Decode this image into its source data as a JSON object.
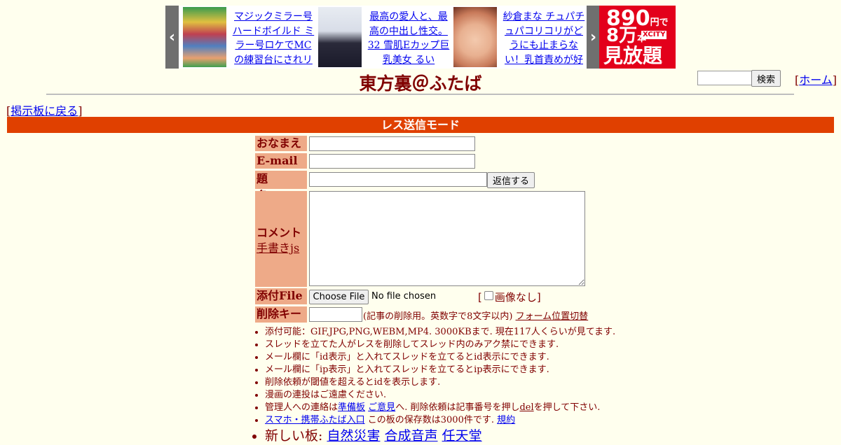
{
  "ads": {
    "prev": "‹",
    "next": "›",
    "items": [
      {
        "text": "マジックミラー号ハードボイルド ミラー号ロケでMCの練習台にされリハ"
      },
      {
        "text": "最高の愛人と、最高の中出し性交。32 雪肌Eカップ巨乳美女 るい"
      },
      {
        "text": "紗倉まな チュパチュパコリコリがどうにも止まらない！乳首責めが好"
      }
    ],
    "banner": {
      "line1": "890",
      "line1_unit": "円で",
      "line2": "8万",
      "line2_unit": "本",
      "brand": "XCITY",
      "line3": "見放題"
    }
  },
  "header": {
    "title": "東方裏＠ふたば",
    "search_button": "検索",
    "home_link": "ホーム",
    "back_link": "掲示板に戻る"
  },
  "mode_label": "レス送信モード",
  "form": {
    "name_label": "おなまえ",
    "email_label": "E-mail",
    "subject_label": "題　名",
    "reply_button": "返信する",
    "comment_label": "コメント",
    "tegaki_link": "手書きjs",
    "file_label": "添付File",
    "choose_file": "Choose File",
    "no_file": "No file chosen",
    "no_image": "画像なし",
    "delkey_label": "削除キー",
    "delkey_note": "(記事の削除用。英数字で8文字以内)",
    "form_toggle": "フォーム位置切替"
  },
  "notes": {
    "n1": "添付可能：GIF,JPG,PNG,WEBM,MP4. 3000KBまで. 現在117人くらいが見てます.",
    "n2": "スレッドを立てた人がレスを削除してスレッド内のみアク禁にできます.",
    "n3": "メール欄に「id表示」と入れてスレッドを立てるとid表示にできます.",
    "n4": "メール欄に「ip表示」と入れてスレッドを立てるとip表示にできます.",
    "n5": "削除依頼が閾値を超えるとidを表示します.",
    "n6": "漫画の連投はご遠慮ください.",
    "n7_pre": "管理人への連絡は",
    "n7_link1": "準備板",
    "n7_link2": "ご意見",
    "n7_mid": "へ. 削除依頼は記事番号を押し",
    "n7_del": "del",
    "n7_post": "を押して下さい.",
    "n8_link": "スマホ・携帯ふたば入口",
    "n8_mid": " この板の保存数は3000件です.",
    "n8_rules": "規約",
    "n9_label": "新しい板: ",
    "n9_b1": "自然災害",
    "n9_b2": "合成音声",
    "n9_b3": "任天堂"
  },
  "colors": {
    "background": "#ffffee",
    "text": "#800000",
    "accent": "#e04000",
    "label_bg": "#eeaa88",
    "link": "#0000ee"
  }
}
